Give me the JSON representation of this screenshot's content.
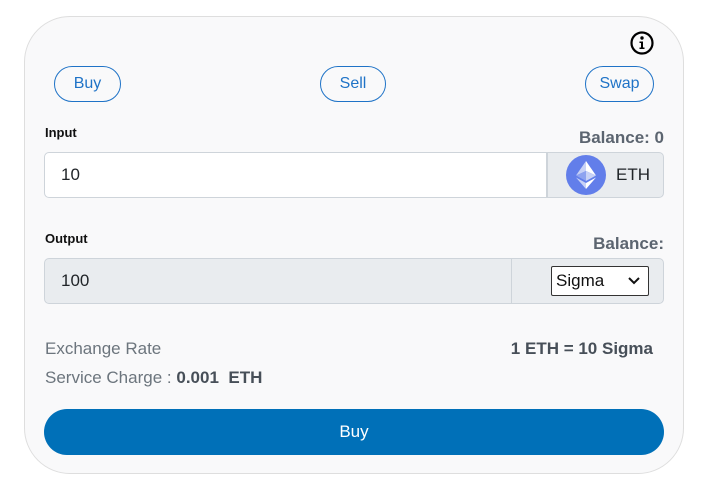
{
  "tabs": {
    "buy": "Buy",
    "sell": "Sell",
    "swap": "Swap"
  },
  "input": {
    "label": "Input",
    "balance": "Balance: 0",
    "value": "10",
    "token": "ETH"
  },
  "output": {
    "label": "Output",
    "balance": "Balance:",
    "value": "100",
    "token_selected": "Sigma"
  },
  "exchange": {
    "label": "Exchange Rate",
    "rate": "1 ETH = 10 Sigma"
  },
  "service": {
    "label": "Service Charge :",
    "amount": "0.001",
    "unit": "ETH"
  },
  "action": {
    "label": "Buy"
  },
  "icons": {
    "info": "info-icon",
    "eth": "ethereum-icon",
    "dropdown": "chevron-down-icon"
  },
  "colors": {
    "accent": "#1f73c7",
    "primary_button": "#0070b8",
    "eth": "#627eea"
  }
}
